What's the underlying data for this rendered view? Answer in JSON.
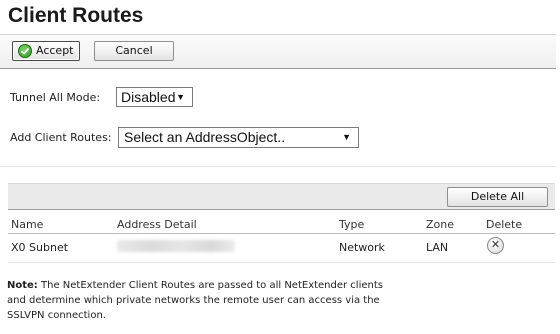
{
  "page": {
    "title": "Client Routes"
  },
  "toolbar": {
    "accept_label": "Accept",
    "cancel_label": "Cancel"
  },
  "form": {
    "tunnel_all_mode": {
      "label": "Tunnel All Mode:",
      "value": "Disabled"
    },
    "add_client_routes": {
      "label": "Add Client Routes:",
      "value": "Select an AddressObject.."
    }
  },
  "table": {
    "delete_all_label": "Delete All",
    "columns": [
      "Name",
      "Address Detail",
      "Type",
      "Zone",
      "Delete"
    ],
    "rows": [
      {
        "name": "X0 Subnet",
        "type": "Network",
        "zone": "LAN"
      }
    ]
  },
  "note": {
    "label": "Note:",
    "text": "The NetExtender Client Routes are passed to all NetExtender clients and determine which private networks the remote user can access via the SSLVPN connection."
  },
  "icons": {
    "accept": "check-circle-icon",
    "delete": "close-circle-icon"
  },
  "colors": {
    "accept_icon": "#2c9a1e"
  }
}
